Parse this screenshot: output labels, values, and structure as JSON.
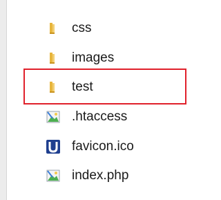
{
  "explorer": {
    "items": [
      {
        "name": "css",
        "type": "folder",
        "icon": "folder-icon"
      },
      {
        "name": "images",
        "type": "folder",
        "icon": "folder-icon"
      },
      {
        "name": "test",
        "type": "folder",
        "icon": "folder-icon",
        "highlighted": true
      },
      {
        "name": ".htaccess",
        "type": "file",
        "icon": "image-file-icon"
      },
      {
        "name": "favicon.ico",
        "type": "file",
        "icon": "u-app-icon"
      },
      {
        "name": "index.php",
        "type": "file",
        "icon": "image-file-icon"
      }
    ],
    "highlight_color": "#e0202a",
    "folder_color": "#e7b53c"
  }
}
